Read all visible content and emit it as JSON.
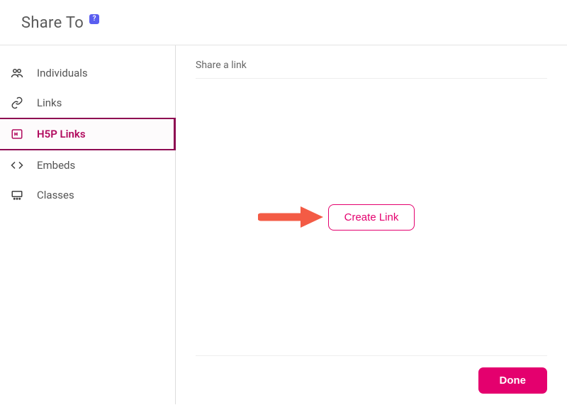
{
  "header": {
    "title": "Share To",
    "help_badge": "?"
  },
  "sidebar": {
    "items": [
      {
        "label": "Individuals",
        "icon": "group-icon",
        "active": false
      },
      {
        "label": "Links",
        "icon": "link-icon",
        "active": false
      },
      {
        "label": "H5P Links",
        "icon": "h5p-icon",
        "active": true
      },
      {
        "label": "Embeds",
        "icon": "code-icon",
        "active": false
      },
      {
        "label": "Classes",
        "icon": "class-icon",
        "active": false
      }
    ]
  },
  "main": {
    "section_heading": "Share a link",
    "create_link_label": "Create Link",
    "done_label": "Done"
  },
  "colors": {
    "accent_magenta": "#e4006e",
    "accent_dark": "#8e0a52",
    "arrow": "#f35b45"
  }
}
